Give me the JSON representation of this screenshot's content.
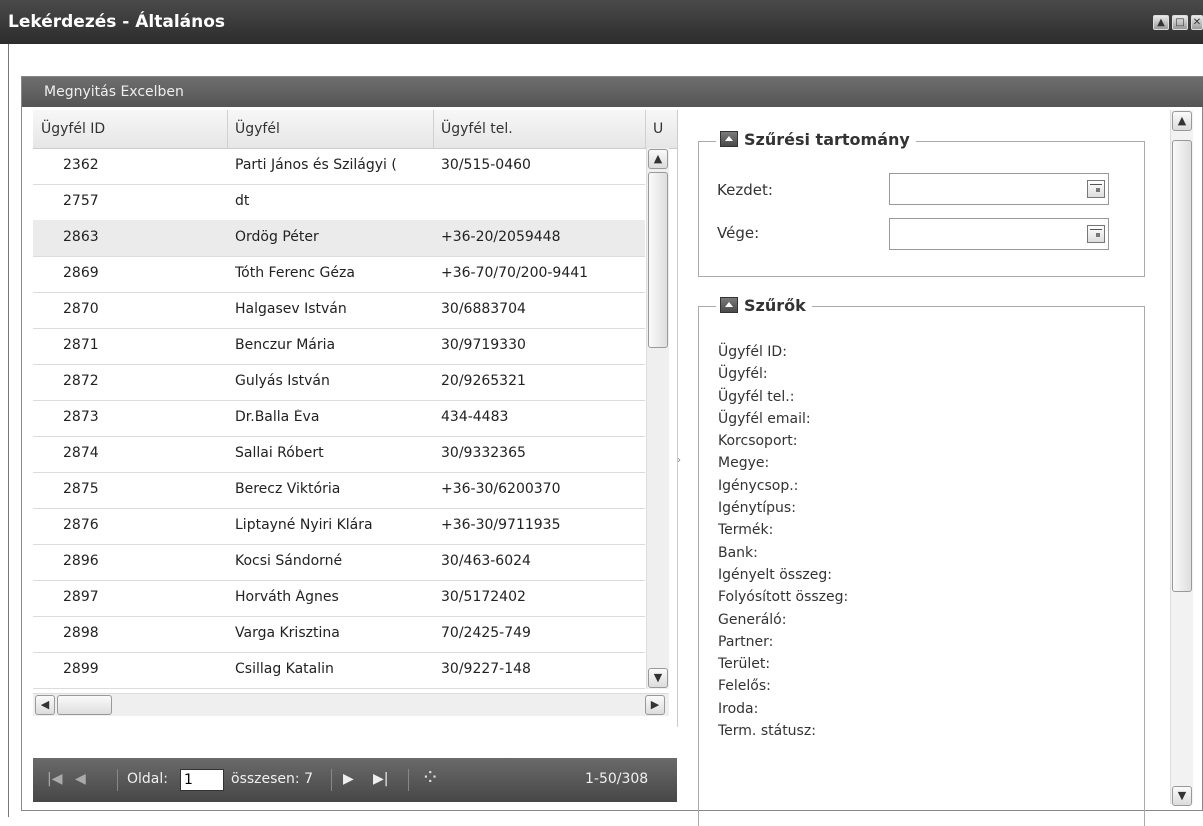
{
  "window": {
    "title": "Lekérdezés - Általános"
  },
  "toolbar": {
    "excel_label": "Megnyitás Excelben"
  },
  "grid": {
    "columns": [
      "Ügyfél ID",
      "Ügyfél",
      "Ügyfél tel.",
      "Ü"
    ],
    "rows": [
      {
        "id": "2362",
        "name": "Parti János és Szilágyi (",
        "tel": "30/515-0460"
      },
      {
        "id": "2757",
        "name": "dt",
        "tel": ""
      },
      {
        "id": "2863",
        "name": "Ördög Péter",
        "tel": "+36-20/2059448"
      },
      {
        "id": "2869",
        "name": "Tóth Ferenc Géza",
        "tel": "+36-70/70/200-9441"
      },
      {
        "id": "2870",
        "name": "Halgasev István",
        "tel": "30/6883704"
      },
      {
        "id": "2871",
        "name": "Benczur Mária",
        "tel": "30/9719330"
      },
      {
        "id": "2872",
        "name": "Gulyás István",
        "tel": "20/9265321"
      },
      {
        "id": "2873",
        "name": "Dr.Balla Éva",
        "tel": "434-4483"
      },
      {
        "id": "2874",
        "name": "Sallai Róbert",
        "tel": "30/9332365"
      },
      {
        "id": "2875",
        "name": "Berecz Viktória",
        "tel": "+36-30/6200370"
      },
      {
        "id": "2876",
        "name": "Liptayné Nyiri Klára",
        "tel": "+36-30/9711935"
      },
      {
        "id": "2896",
        "name": "Kocsi Sándorné",
        "tel": "30/463-6024"
      },
      {
        "id": "2897",
        "name": "Horváth Ágnes",
        "tel": "30/5172402"
      },
      {
        "id": "2898",
        "name": "Varga Krisztina",
        "tel": "70/2425-749"
      },
      {
        "id": "2899",
        "name": "Csillag Katalin",
        "tel": "30/9227-148"
      }
    ],
    "selected_row_index": 2
  },
  "pager": {
    "page_label": "Oldal:",
    "page_value": "1",
    "total_label": "összesen: 7",
    "range_label": "1-50/308"
  },
  "date_range": {
    "legend": "Szűrési tartomány",
    "start_label": "Kezdet:",
    "end_label": "Vége:",
    "start_value": "",
    "end_value": ""
  },
  "filters": {
    "legend": "Szűrők",
    "items": [
      "Ügyfél ID:",
      "Ügyfél:",
      "Ügyfél tel.:",
      "Ügyfél email:",
      "Korcsoport:",
      "Megye:",
      "Igénycsop.:",
      "Igénytípus:",
      "Termék:",
      "Bank:",
      "Igényelt összeg:",
      "Folyósított összeg:",
      "Generáló:",
      "Partner:",
      "Terület:",
      "Felelős:",
      "Iroda:",
      "Term. státusz:"
    ]
  }
}
